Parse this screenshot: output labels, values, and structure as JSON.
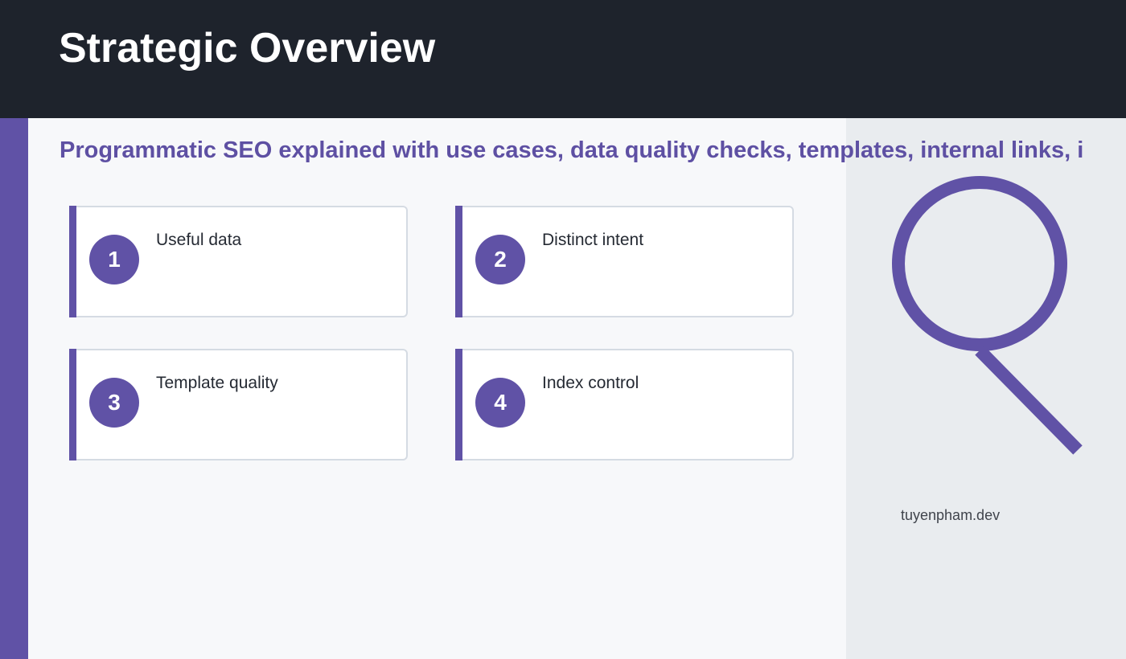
{
  "header": {
    "title": "Strategic Overview"
  },
  "subtitle": "Programmatic SEO explained with use cases, data quality checks, templates, internal links, i",
  "cards": [
    {
      "number": "1",
      "label": "Useful data"
    },
    {
      "number": "2",
      "label": "Distinct intent"
    },
    {
      "number": "3",
      "label": "Template quality"
    },
    {
      "number": "4",
      "label": "Index control"
    }
  ],
  "side": {
    "icon": "magnifier-icon",
    "footer": "tuyenpham.dev"
  },
  "colors": {
    "header_bg": "#1e232c",
    "accent": "#6052a6",
    "page_bg": "#f7f8fa",
    "panel_bg": "#e9ecef"
  }
}
